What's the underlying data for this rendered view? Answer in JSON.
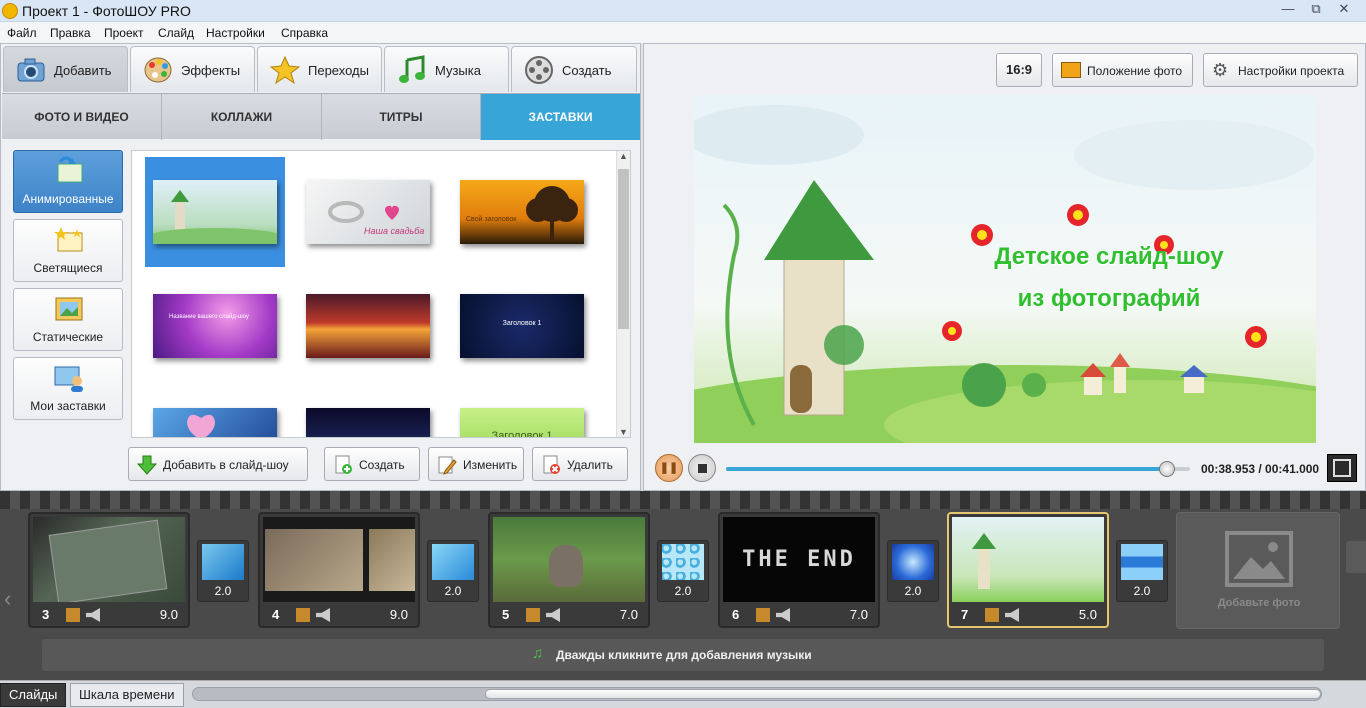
{
  "window": {
    "title": "Проект 1 - ФотоШОУ PRO"
  },
  "menu": [
    "Файл",
    "Правка",
    "Проект",
    "Слайд",
    "Настройки",
    "Справка"
  ],
  "main_tabs": [
    {
      "label": "Добавить",
      "icon": "camera-icon",
      "active": true
    },
    {
      "label": "Эффекты",
      "icon": "palette-icon",
      "active": false
    },
    {
      "label": "Переходы",
      "icon": "star-icon",
      "active": false
    },
    {
      "label": "Музыка",
      "icon": "music-note-icon",
      "active": false
    },
    {
      "label": "Создать",
      "icon": "film-reel-icon",
      "active": false
    }
  ],
  "sub_tabs": [
    {
      "label": "ФОТО И ВИДЕО",
      "active": false
    },
    {
      "label": "КОЛЛАЖИ",
      "active": false
    },
    {
      "label": "ТИТРЫ",
      "active": false
    },
    {
      "label": "ЗАСТАВКИ",
      "active": true
    }
  ],
  "categories": [
    {
      "label": "Анимированные",
      "active": true
    },
    {
      "label": "Светящиеся",
      "active": false
    },
    {
      "label": "Статические",
      "active": false
    },
    {
      "label": "Мои заставки",
      "active": false
    }
  ],
  "gallery": {
    "thumbs": [
      {
        "text": "",
        "selected": true
      },
      {
        "text": "Наша свадьба"
      },
      {
        "text": "Свой заголовок"
      },
      {
        "text": "Название вашего слайд-шоу"
      },
      {
        "text": ""
      },
      {
        "text": "Заголовок 1"
      },
      {
        "text": ""
      },
      {
        "text": ""
      },
      {
        "text": "Заголовок 1"
      }
    ]
  },
  "actions": {
    "add_to_show": "Добавить в слайд-шоу",
    "create": "Создать",
    "edit": "Изменить",
    "delete": "Удалить"
  },
  "preview_toolbar": {
    "aspect": "16:9",
    "photo_position": "Положение фото",
    "project_settings": "Настройки проекта"
  },
  "preview": {
    "line1": "Детское слайд-шоу",
    "line2": "из фотографий"
  },
  "player": {
    "time": "00:38.953 / 00:41.000",
    "progress": 0.95
  },
  "slides": [
    {
      "num": "3",
      "dur": "9.0",
      "active": false,
      "trans": "2.0"
    },
    {
      "num": "4",
      "dur": "9.0",
      "active": false,
      "trans": "2.0"
    },
    {
      "num": "5",
      "dur": "7.0",
      "active": false,
      "trans": "2.0"
    },
    {
      "num": "6",
      "dur": "7.0",
      "active": false,
      "trans": "2.0"
    },
    {
      "num": "7",
      "dur": "5.0",
      "active": true,
      "trans": "2.0"
    }
  ],
  "slide6_text": "THE END",
  "add_photo": "Добавьте фото",
  "music_hint": "Дважды кликните для добавления музыки",
  "bottom_tabs": [
    {
      "label": "Слайды",
      "active": true
    },
    {
      "label": "Шкала времени",
      "active": false
    }
  ],
  "colors": {
    "accent": "#38a5d8",
    "active_slide": "#e6c66e",
    "title_green": "#2fbf2f"
  }
}
